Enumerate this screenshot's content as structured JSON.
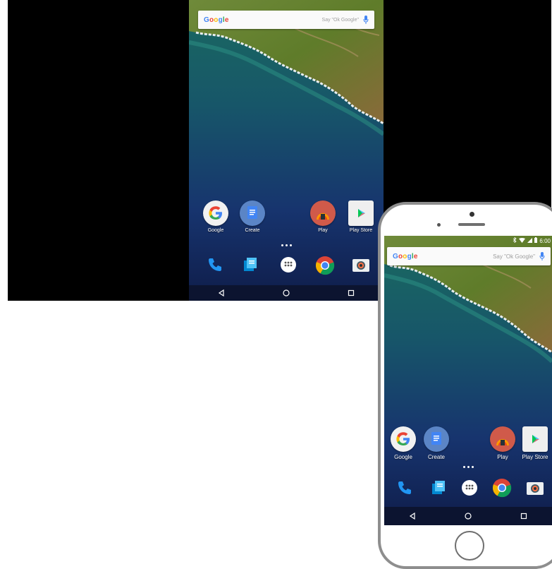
{
  "search": {
    "logo": "Google",
    "hint_big": "Say \"Ok Google\"",
    "hint_small": "Say \"Ok Google\""
  },
  "status": {
    "time": "6:00"
  },
  "apps": [
    {
      "label": "Google"
    },
    {
      "label": "Create"
    },
    {
      "label": "Play"
    },
    {
      "label": "Play Store"
    }
  ],
  "dock": [
    "phone-icon",
    "messenger-icon",
    "app-drawer-icon",
    "chrome-icon",
    "camera-icon"
  ],
  "navbar": [
    "back-icon",
    "home-icon",
    "recents-icon"
  ],
  "colors": {
    "google_blue": "#4285f4",
    "google_red": "#ea4335",
    "google_yellow": "#fbbc05",
    "google_green": "#34a853"
  }
}
